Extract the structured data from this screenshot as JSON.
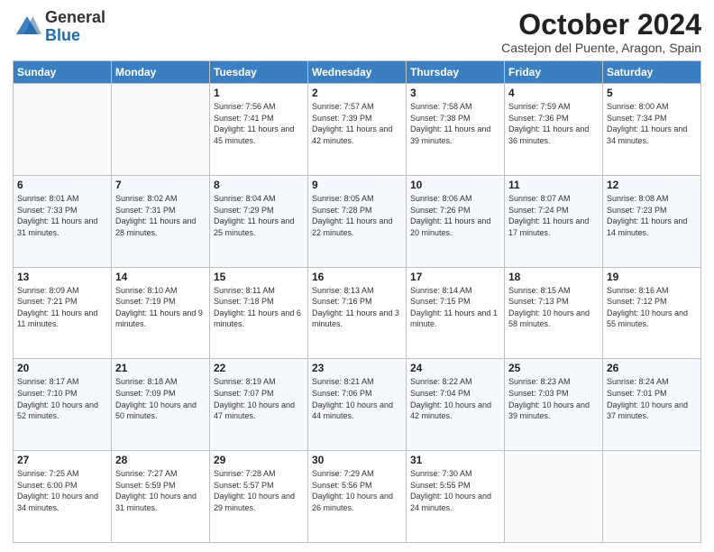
{
  "header": {
    "logo": {
      "general": "General",
      "blue": "Blue"
    },
    "month": "October 2024",
    "location": "Castejon del Puente, Aragon, Spain"
  },
  "weekdays": [
    "Sunday",
    "Monday",
    "Tuesday",
    "Wednesday",
    "Thursday",
    "Friday",
    "Saturday"
  ],
  "weeks": [
    [
      {
        "day": "",
        "sunrise": "",
        "sunset": "",
        "daylight": ""
      },
      {
        "day": "",
        "sunrise": "",
        "sunset": "",
        "daylight": ""
      },
      {
        "day": "1",
        "sunrise": "Sunrise: 7:56 AM",
        "sunset": "Sunset: 7:41 PM",
        "daylight": "Daylight: 11 hours and 45 minutes."
      },
      {
        "day": "2",
        "sunrise": "Sunrise: 7:57 AM",
        "sunset": "Sunset: 7:39 PM",
        "daylight": "Daylight: 11 hours and 42 minutes."
      },
      {
        "day": "3",
        "sunrise": "Sunrise: 7:58 AM",
        "sunset": "Sunset: 7:38 PM",
        "daylight": "Daylight: 11 hours and 39 minutes."
      },
      {
        "day": "4",
        "sunrise": "Sunrise: 7:59 AM",
        "sunset": "Sunset: 7:36 PM",
        "daylight": "Daylight: 11 hours and 36 minutes."
      },
      {
        "day": "5",
        "sunrise": "Sunrise: 8:00 AM",
        "sunset": "Sunset: 7:34 PM",
        "daylight": "Daylight: 11 hours and 34 minutes."
      }
    ],
    [
      {
        "day": "6",
        "sunrise": "Sunrise: 8:01 AM",
        "sunset": "Sunset: 7:33 PM",
        "daylight": "Daylight: 11 hours and 31 minutes."
      },
      {
        "day": "7",
        "sunrise": "Sunrise: 8:02 AM",
        "sunset": "Sunset: 7:31 PM",
        "daylight": "Daylight: 11 hours and 28 minutes."
      },
      {
        "day": "8",
        "sunrise": "Sunrise: 8:04 AM",
        "sunset": "Sunset: 7:29 PM",
        "daylight": "Daylight: 11 hours and 25 minutes."
      },
      {
        "day": "9",
        "sunrise": "Sunrise: 8:05 AM",
        "sunset": "Sunset: 7:28 PM",
        "daylight": "Daylight: 11 hours and 22 minutes."
      },
      {
        "day": "10",
        "sunrise": "Sunrise: 8:06 AM",
        "sunset": "Sunset: 7:26 PM",
        "daylight": "Daylight: 11 hours and 20 minutes."
      },
      {
        "day": "11",
        "sunrise": "Sunrise: 8:07 AM",
        "sunset": "Sunset: 7:24 PM",
        "daylight": "Daylight: 11 hours and 17 minutes."
      },
      {
        "day": "12",
        "sunrise": "Sunrise: 8:08 AM",
        "sunset": "Sunset: 7:23 PM",
        "daylight": "Daylight: 11 hours and 14 minutes."
      }
    ],
    [
      {
        "day": "13",
        "sunrise": "Sunrise: 8:09 AM",
        "sunset": "Sunset: 7:21 PM",
        "daylight": "Daylight: 11 hours and 11 minutes."
      },
      {
        "day": "14",
        "sunrise": "Sunrise: 8:10 AM",
        "sunset": "Sunset: 7:19 PM",
        "daylight": "Daylight: 11 hours and 9 minutes."
      },
      {
        "day": "15",
        "sunrise": "Sunrise: 8:11 AM",
        "sunset": "Sunset: 7:18 PM",
        "daylight": "Daylight: 11 hours and 6 minutes."
      },
      {
        "day": "16",
        "sunrise": "Sunrise: 8:13 AM",
        "sunset": "Sunset: 7:16 PM",
        "daylight": "Daylight: 11 hours and 3 minutes."
      },
      {
        "day": "17",
        "sunrise": "Sunrise: 8:14 AM",
        "sunset": "Sunset: 7:15 PM",
        "daylight": "Daylight: 11 hours and 1 minute."
      },
      {
        "day": "18",
        "sunrise": "Sunrise: 8:15 AM",
        "sunset": "Sunset: 7:13 PM",
        "daylight": "Daylight: 10 hours and 58 minutes."
      },
      {
        "day": "19",
        "sunrise": "Sunrise: 8:16 AM",
        "sunset": "Sunset: 7:12 PM",
        "daylight": "Daylight: 10 hours and 55 minutes."
      }
    ],
    [
      {
        "day": "20",
        "sunrise": "Sunrise: 8:17 AM",
        "sunset": "Sunset: 7:10 PM",
        "daylight": "Daylight: 10 hours and 52 minutes."
      },
      {
        "day": "21",
        "sunrise": "Sunrise: 8:18 AM",
        "sunset": "Sunset: 7:09 PM",
        "daylight": "Daylight: 10 hours and 50 minutes."
      },
      {
        "day": "22",
        "sunrise": "Sunrise: 8:19 AM",
        "sunset": "Sunset: 7:07 PM",
        "daylight": "Daylight: 10 hours and 47 minutes."
      },
      {
        "day": "23",
        "sunrise": "Sunrise: 8:21 AM",
        "sunset": "Sunset: 7:06 PM",
        "daylight": "Daylight: 10 hours and 44 minutes."
      },
      {
        "day": "24",
        "sunrise": "Sunrise: 8:22 AM",
        "sunset": "Sunset: 7:04 PM",
        "daylight": "Daylight: 10 hours and 42 minutes."
      },
      {
        "day": "25",
        "sunrise": "Sunrise: 8:23 AM",
        "sunset": "Sunset: 7:03 PM",
        "daylight": "Daylight: 10 hours and 39 minutes."
      },
      {
        "day": "26",
        "sunrise": "Sunrise: 8:24 AM",
        "sunset": "Sunset: 7:01 PM",
        "daylight": "Daylight: 10 hours and 37 minutes."
      }
    ],
    [
      {
        "day": "27",
        "sunrise": "Sunrise: 7:25 AM",
        "sunset": "Sunset: 6:00 PM",
        "daylight": "Daylight: 10 hours and 34 minutes."
      },
      {
        "day": "28",
        "sunrise": "Sunrise: 7:27 AM",
        "sunset": "Sunset: 5:59 PM",
        "daylight": "Daylight: 10 hours and 31 minutes."
      },
      {
        "day": "29",
        "sunrise": "Sunrise: 7:28 AM",
        "sunset": "Sunset: 5:57 PM",
        "daylight": "Daylight: 10 hours and 29 minutes."
      },
      {
        "day": "30",
        "sunrise": "Sunrise: 7:29 AM",
        "sunset": "Sunset: 5:56 PM",
        "daylight": "Daylight: 10 hours and 26 minutes."
      },
      {
        "day": "31",
        "sunrise": "Sunrise: 7:30 AM",
        "sunset": "Sunset: 5:55 PM",
        "daylight": "Daylight: 10 hours and 24 minutes."
      },
      {
        "day": "",
        "sunrise": "",
        "sunset": "",
        "daylight": ""
      },
      {
        "day": "",
        "sunrise": "",
        "sunset": "",
        "daylight": ""
      }
    ]
  ]
}
